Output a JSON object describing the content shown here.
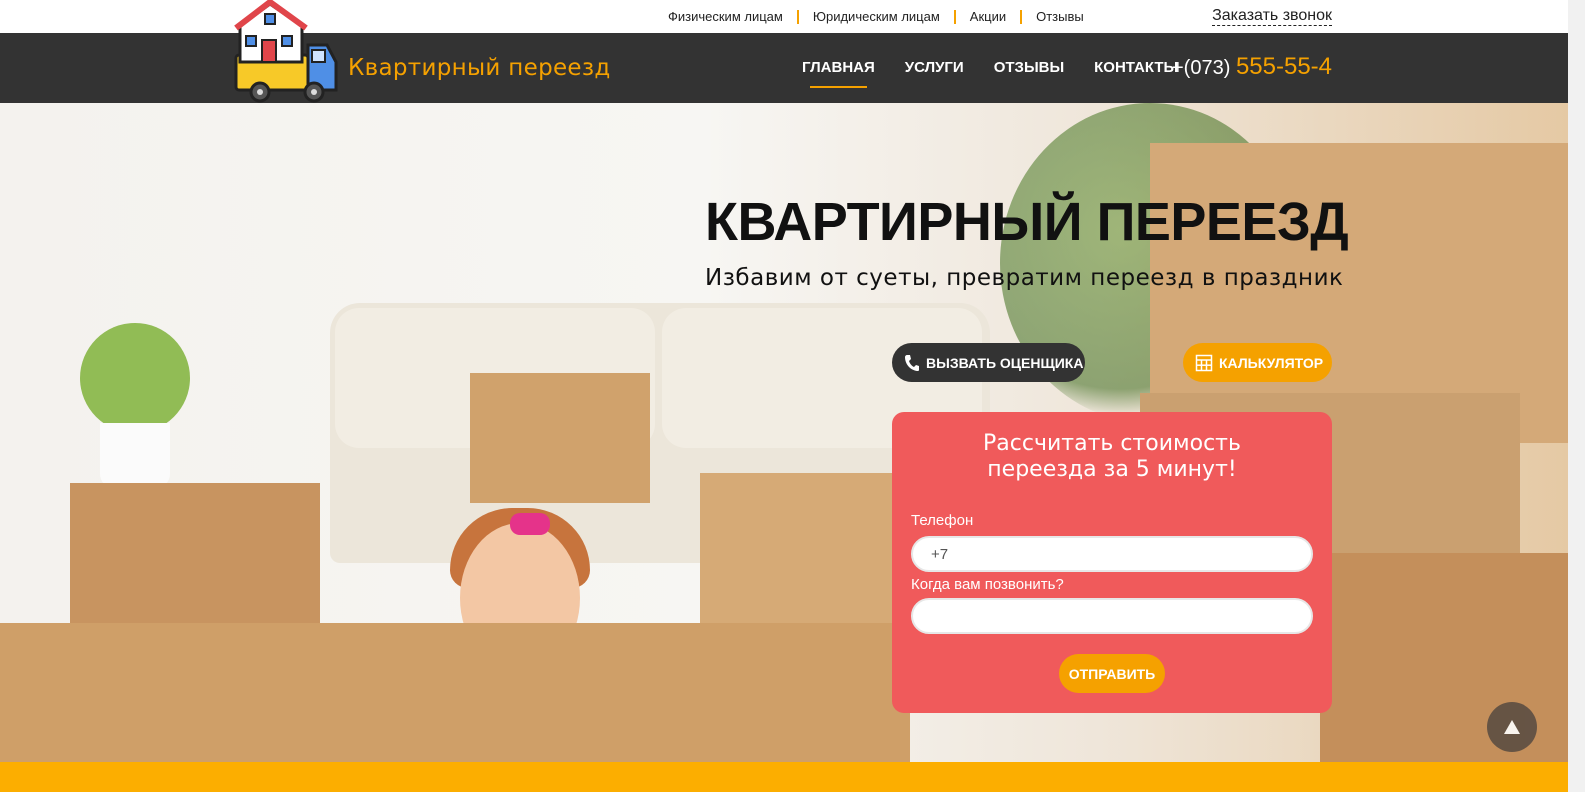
{
  "topbar": {
    "links": [
      "Физическим лицам",
      "Юридическим лицам",
      "Акции",
      "Отзывы"
    ],
    "callback": "Заказать звонок"
  },
  "navbar": {
    "brand": "Квартирный переезд",
    "items": [
      "ГЛАВНАЯ",
      "УСЛУГИ",
      "ОТЗЫВЫ",
      "КОНТАКТЫ"
    ],
    "active_item": "ГЛАВНАЯ",
    "phone_prefix": "+(073)",
    "phone_number": "555-55-4"
  },
  "hero": {
    "title": "КВАРТИРНЫЙ ПЕРЕЕЗД",
    "subtitle": "Избавим от суеты, превратим переезд в праздник",
    "appraiser_button": "ВЫЗВАТЬ ОЦЕНЩИКА",
    "calculator_button": "КАЛЬКУЛЯТОР"
  },
  "form": {
    "title_line1": "Рассчитать стоимость",
    "title_line2": "переезда за 5 минут!",
    "phone_label": "Телефон",
    "phone_value": "+7",
    "time_label": "Когда вам позвонить?",
    "time_value": "",
    "submit": "ОТПРАВИТЬ"
  },
  "scroll_top_icon": "arrow-up-icon",
  "colors": {
    "accent": "#f5a100",
    "dark": "#333333",
    "form_bg": "#f05a5b"
  }
}
